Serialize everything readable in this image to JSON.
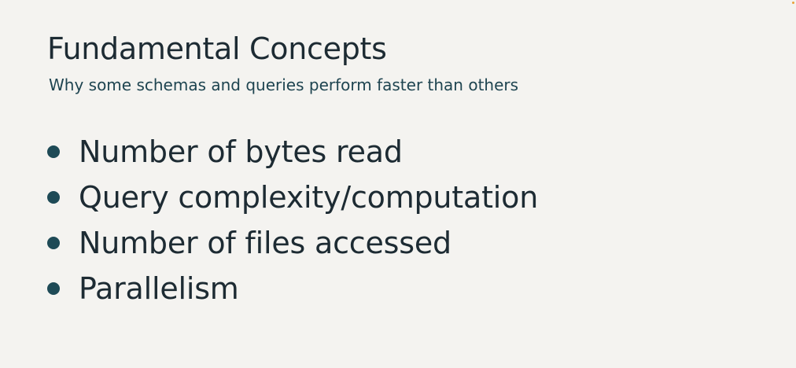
{
  "slide": {
    "title": "Fundamental Concepts",
    "subtitle": "Why some schemas and queries perform faster than others",
    "bullets": [
      {
        "text": "Number of bytes read"
      },
      {
        "text": "Query complexity/computation"
      },
      {
        "text": "Number of files accessed"
      },
      {
        "text": "Parallelism"
      }
    ]
  },
  "colors": {
    "background": "#f4f3f0",
    "title": "#1d2b33",
    "subtitle": "#1e4450",
    "bullet_dot": "#1e4a56"
  }
}
